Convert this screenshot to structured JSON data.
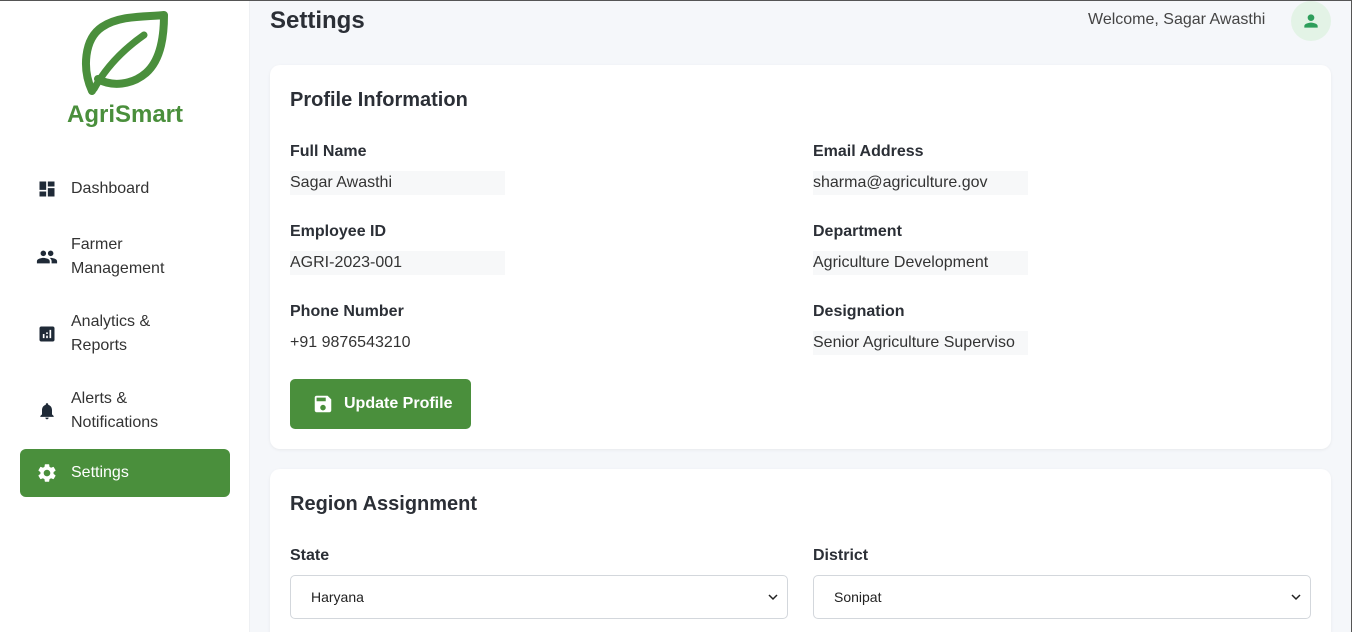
{
  "app": {
    "name": "AgriSmart",
    "brand_color": "#4a8f3c"
  },
  "sidebar": {
    "items": [
      {
        "label": "Dashboard",
        "icon": "dashboard-icon",
        "active": false
      },
      {
        "label": "Farmer Management",
        "icon": "people-icon",
        "active": false
      },
      {
        "label": "Analytics & Reports",
        "icon": "analytics-icon",
        "active": false
      },
      {
        "label": "Alerts & Notifications",
        "icon": "bell-icon",
        "active": false
      },
      {
        "label": "Settings",
        "icon": "gear-icon",
        "active": true
      }
    ]
  },
  "header": {
    "title": "Settings",
    "welcome": "Welcome, Sagar Awasthi",
    "avatar_icon": "user-icon"
  },
  "profile": {
    "title": "Profile Information",
    "full_name_label": "Full Name",
    "full_name": "Sagar Awasthi",
    "email_label": "Email Address",
    "email": "sharma@agriculture.gov",
    "employee_id_label": "Employee ID",
    "employee_id": "AGRI-2023-001",
    "department_label": "Department",
    "department": "Agriculture Development",
    "phone_label": "Phone Number",
    "phone": "+91 9876543210",
    "designation_label": "Designation",
    "designation": "Senior Agriculture Superviso",
    "update_button": "Update Profile",
    "update_icon": "save-icon"
  },
  "region": {
    "title": "Region Assignment",
    "state_label": "State",
    "state_value": "Haryana",
    "district_label": "District",
    "district_value": "Sonipat"
  }
}
